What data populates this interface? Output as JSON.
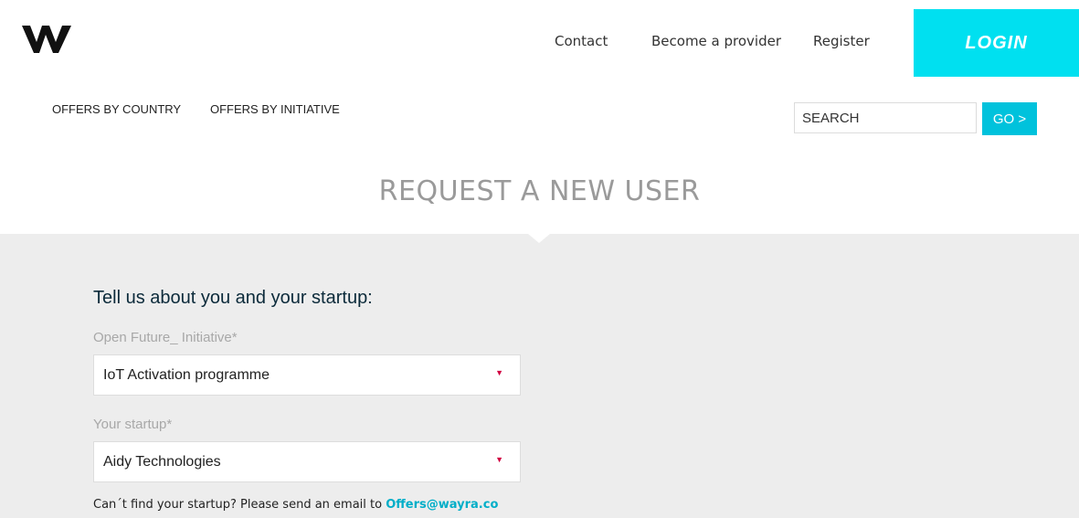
{
  "header": {
    "nav": [
      {
        "label": "Contact"
      },
      {
        "label": "Become a provider"
      },
      {
        "label": "Register"
      }
    ],
    "login_label": "LOGIN"
  },
  "subnav": [
    {
      "label": "OFFERS BY COUNTRY"
    },
    {
      "label": "OFFERS BY INITIATIVE"
    }
  ],
  "search": {
    "placeholder": "SEARCH",
    "value": "",
    "go_label": "GO >"
  },
  "page": {
    "title": "REQUEST A NEW USER"
  },
  "form": {
    "heading": "Tell us about you and your startup:",
    "fields": [
      {
        "label": "Open Future_ Initiative*",
        "value": "IoT Activation programme"
      },
      {
        "label": "Your startup*",
        "value": "Aidy Technologies"
      }
    ],
    "help_text": "Can´t find your startup? Please send an email to ",
    "help_link": "Offers@wayra.co"
  },
  "colors": {
    "accent": "#00e0f0",
    "button": "#00c2dc",
    "panel": "#ededed",
    "arrow": "#d10040"
  }
}
